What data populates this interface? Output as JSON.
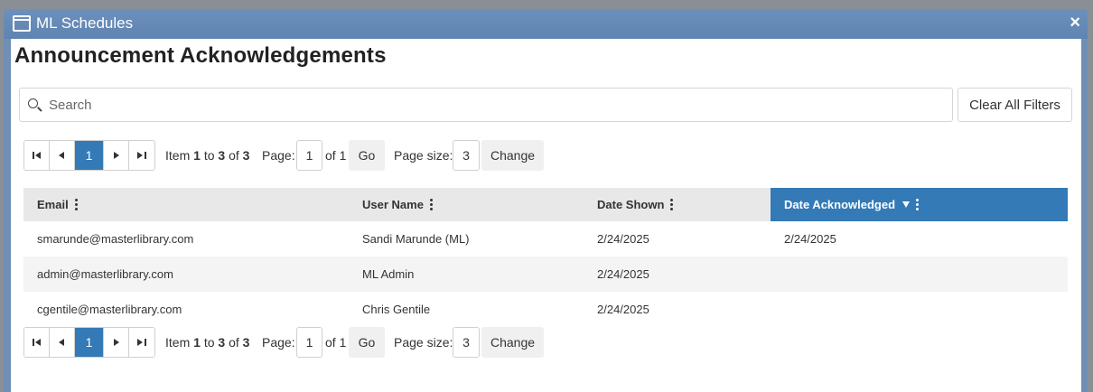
{
  "window": {
    "title": "ML Schedules",
    "close_glyph": "×"
  },
  "page": {
    "title": "Announcement Acknowledgements"
  },
  "search": {
    "placeholder": "Search",
    "value": ""
  },
  "clear_filters_label": "Clear All Filters",
  "pager": {
    "current_page": "1",
    "item_prefix": "Item",
    "item_from": "1",
    "item_to_word": "to",
    "item_to": "3",
    "item_of_word": "of",
    "item_total": "3",
    "page_label": "Page:",
    "page_value": "1",
    "page_of": "of 1",
    "go_label": "Go",
    "size_label": "Page size:",
    "size_value": "3",
    "change_label": "Change"
  },
  "table": {
    "columns": [
      {
        "label": "Email"
      },
      {
        "label": "User Name"
      },
      {
        "label": "Date Shown"
      },
      {
        "label": "Date Acknowledged"
      }
    ],
    "rows": [
      [
        "smarunde@masterlibrary.com",
        "Sandi Marunde (ML)",
        "2/24/2025",
        "2/24/2025"
      ],
      [
        "admin@masterlibrary.com",
        "ML Admin",
        "2/24/2025",
        ""
      ],
      [
        "cgentile@masterlibrary.com",
        "Chris Gentile",
        "2/24/2025",
        ""
      ]
    ]
  },
  "colors": {
    "accent": "#337ab7",
    "titlebar": "#6d90bb"
  },
  "icons": [
    "window-icon",
    "close-icon",
    "search-icon",
    "first-page-icon",
    "prev-page-icon",
    "next-page-icon",
    "last-page-icon",
    "column-menu-icon",
    "sort-desc-icon"
  ]
}
